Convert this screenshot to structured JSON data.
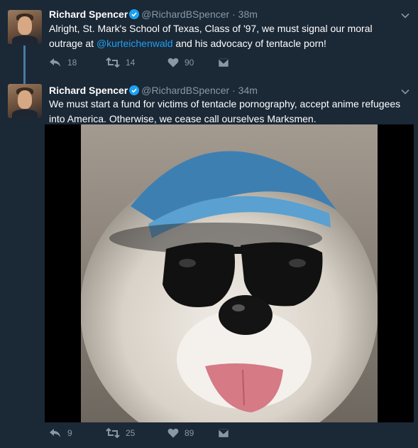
{
  "tweets": [
    {
      "author_name": "Richard Spencer",
      "handle": "@RichardBSpencer",
      "separator": "·",
      "time": "38m",
      "text_before_mention": "Alright, St. Mark's School of Texas, Class of '97, we must signal our moral outrage at ",
      "mention": "@kurteichenwald",
      "text_after_mention": " and his advocacy of tentacle porn!",
      "replies": "18",
      "retweets": "14",
      "likes": "90"
    },
    {
      "author_name": "Richard Spencer",
      "handle": "@RichardBSpencer",
      "separator": "·",
      "time": "34m",
      "text": "We must start a fund for victims of tentacle pornography, accept anime refugees into America. Otherwise, we cease call ourselves Marksmen.",
      "media_description": "dog-wearing-visor-and-sunglasses",
      "replies": "9",
      "retweets": "25",
      "likes": "89"
    }
  ],
  "icons": {
    "verified": "verified-badge-icon",
    "caret": "chevron-down-icon",
    "reply": "reply-icon",
    "retweet": "retweet-icon",
    "like": "heart-icon",
    "message": "direct-message-icon"
  },
  "colors": {
    "background": "#1b2836",
    "link": "#1da1f2",
    "muted": "#8899a6",
    "thread_line": "#4a7aa3"
  }
}
